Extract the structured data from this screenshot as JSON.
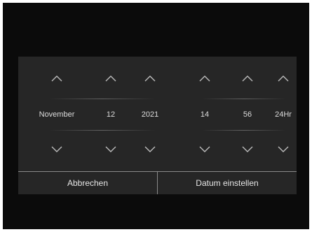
{
  "picker": {
    "columns": [
      {
        "name": "month",
        "value": "November"
      },
      {
        "name": "day",
        "value": "12"
      },
      {
        "name": "year",
        "value": "2021"
      },
      {
        "name": "hour",
        "value": "14"
      },
      {
        "name": "minute",
        "value": "56"
      },
      {
        "name": "format",
        "value": "24Hr"
      }
    ]
  },
  "buttons": {
    "cancel_label": "Abbrechen",
    "confirm_label": "Datum einstellen"
  },
  "colors": {
    "screen_background": "#0b0b0b",
    "dialog_background": "#262626",
    "text": "#dcdcdc",
    "arrow": "#bdbdbd",
    "divider": "#8a8a8a"
  },
  "icons": {
    "increment": "chevron-up-icon",
    "decrement": "chevron-down-icon"
  }
}
